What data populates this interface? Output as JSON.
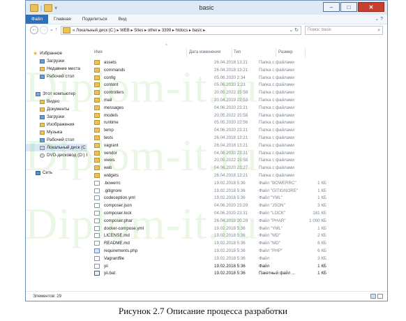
{
  "window": {
    "title": "basic"
  },
  "ribbon": {
    "tabs": [
      "Файл",
      "Главная",
      "Поделиться",
      "Вид"
    ]
  },
  "address": {
    "path": "« Локальный диск (C:) ▸ WEB ▸ Sites ▸ other ▸ 3399 ▸ htdocs ▸ basic ▸",
    "search_placeholder": "Поиск: basic"
  },
  "nav": {
    "favorites": "Избранное",
    "downloads": "Загрузки",
    "recent": "Недавние места",
    "desktop": "Рабочий стол",
    "computer": "Этот компьютер",
    "video": "Видео",
    "documents": "Документы",
    "downloads2": "Загрузки",
    "images": "Изображения",
    "music": "Музыка",
    "desktop2": "Рабочий стол",
    "local_disk": "Локальный диск (C",
    "dvd": "DVD-дисковод (D:) I",
    "network": "Сеть"
  },
  "columns": {
    "name": "Имя",
    "date": "Дата изменения",
    "type": "Тип",
    "size": "Размер"
  },
  "files": [
    {
      "icon": "folder",
      "name": "assets",
      "date": "26.04.2018 13:21",
      "type": "Папка с файлами",
      "size": ""
    },
    {
      "icon": "folder",
      "name": "commands",
      "date": "26.04.2018 13:21",
      "type": "Папка с файлами",
      "size": ""
    },
    {
      "icon": "folder",
      "name": "config",
      "date": "05.06.2020 2:34",
      "type": "Папка с файлами",
      "size": ""
    },
    {
      "icon": "folder",
      "name": "content",
      "date": "05.06.2020 1:23",
      "type": "Папка с файлами",
      "size": ""
    },
    {
      "icon": "folder",
      "name": "controllers",
      "date": "20.05.2022 15:58",
      "type": "Папка с файлами",
      "size": ""
    },
    {
      "icon": "folder",
      "name": "mail",
      "date": "20.04.2019 22:53",
      "type": "Папка с файлами",
      "size": ""
    },
    {
      "icon": "folder",
      "name": "messages",
      "date": "04.06.2020 23:21",
      "type": "Папка с файлами",
      "size": ""
    },
    {
      "icon": "folder",
      "name": "models",
      "date": "20.05.2022 15:58",
      "type": "Папка с файлами",
      "size": ""
    },
    {
      "icon": "folder",
      "name": "runtime",
      "date": "05.05.2020 22:56",
      "type": "Папка с файлами",
      "size": ""
    },
    {
      "icon": "folder",
      "name": "temp",
      "date": "04.06.2020 23:21",
      "type": "Папка с файлами",
      "size": ""
    },
    {
      "icon": "folder",
      "name": "tests",
      "date": "26.04.2018 13:21",
      "type": "Папка с файлами",
      "size": ""
    },
    {
      "icon": "folder",
      "name": "vagrant",
      "date": "26.04.2018 13:21",
      "type": "Папка с файлами",
      "size": ""
    },
    {
      "icon": "folder",
      "name": "vendor",
      "date": "04.06.2020 23:31",
      "type": "Папка с файлами",
      "size": ""
    },
    {
      "icon": "folder",
      "name": "views",
      "date": "20.05.2022 15:58",
      "type": "Папка с файлами",
      "size": ""
    },
    {
      "icon": "folder",
      "name": "web",
      "date": "04.06.2020 23:27",
      "type": "Папка с файлами",
      "size": ""
    },
    {
      "icon": "folder",
      "name": "widgets",
      "date": "26.04.2018 13:21",
      "type": "Папка с файлами",
      "size": ""
    },
    {
      "icon": "file",
      "name": ".bowerrc",
      "date": "19.02.2018 5:36",
      "type": "Файл \"BOWERRC\"",
      "size": "1 КБ"
    },
    {
      "icon": "file",
      "name": ".gitignore",
      "date": "19.02.2018 5:36",
      "type": "Файл \"GITIGNORE\"",
      "size": "1 КБ"
    },
    {
      "icon": "file",
      "name": "codeception.yml",
      "date": "19.02.2018 5:36",
      "type": "Файл \"YML\"",
      "size": "1 КБ"
    },
    {
      "icon": "file",
      "name": "composer.json",
      "date": "04.06.2020 23:29",
      "type": "Файл \"JSON\"",
      "size": "3 КБ"
    },
    {
      "icon": "file",
      "name": "composer.lock",
      "date": "04.06.2020 23:31",
      "type": "Файл \"LOCK\"",
      "size": "181 КБ"
    },
    {
      "icon": "file",
      "name": "composer.phar",
      "date": "26.04.2018 20:29",
      "type": "Файл \"PHAR\"",
      "size": "1 000 КБ"
    },
    {
      "icon": "file",
      "name": "docker-compose.yml",
      "date": "19.02.2018 5:36",
      "type": "Файл \"YML\"",
      "size": "1 КБ"
    },
    {
      "icon": "file",
      "name": "LICENSE.md",
      "date": "19.02.2018 5:36",
      "type": "Файл \"MD\"",
      "size": "2 КБ"
    },
    {
      "icon": "file",
      "name": "README.md",
      "date": "19.02.2018 5:36",
      "type": "Файл \"MD\"",
      "size": "8 КБ"
    },
    {
      "icon": "php",
      "name": "requirements.php",
      "date": "19.02.2018 5:36",
      "type": "Файл \"PHP\"",
      "size": "6 КБ"
    },
    {
      "icon": "file",
      "name": "Vagrantfile",
      "date": "19.02.2018 5:36",
      "type": "Файл",
      "size": "3 КБ"
    },
    {
      "icon": "file",
      "name": "yii",
      "date": "19.02.2018 5:36",
      "type": "Файл",
      "size": "1 КБ",
      "bold": true
    },
    {
      "icon": "bat",
      "name": "yii.bat",
      "date": "19.02.2018 5:36",
      "type": "Пакетный файл ...",
      "size": "1 КБ",
      "bold": true
    }
  ],
  "status": {
    "count": "Элементов: 29"
  },
  "watermark": "Diplom-it.ru",
  "caption": "Рисунок 2.7 Описание процесса разработки"
}
